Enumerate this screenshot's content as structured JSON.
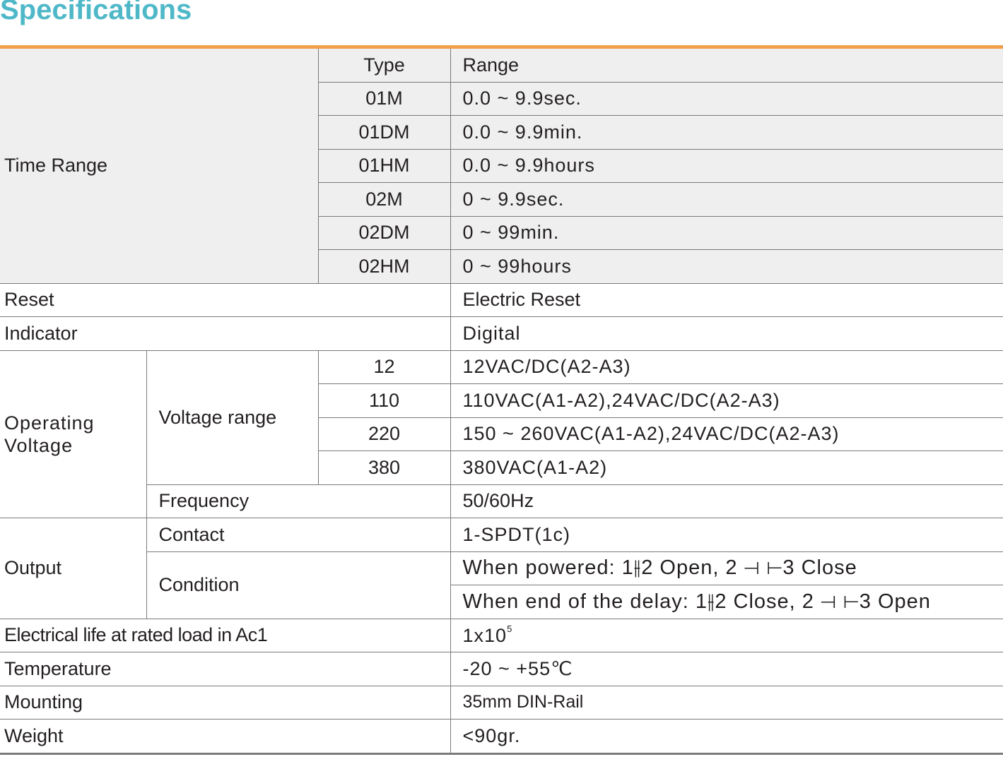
{
  "title": "Specifications",
  "colors": {
    "title": "#4fb8c8",
    "accent_rule": "#f0a04b",
    "shade": "#efefef",
    "border": "#7a7a7a"
  },
  "time_range": {
    "label": "Time Range",
    "header_type": "Type",
    "header_range": "Range",
    "rows": [
      {
        "type": "01M",
        "range": "0.0 ~ 9.9sec."
      },
      {
        "type": "01DM",
        "range": "0.0 ~ 9.9min."
      },
      {
        "type": "01HM",
        "range": "0.0 ~ 9.9hours"
      },
      {
        "type": "02M",
        "range": "0 ~ 9.9sec."
      },
      {
        "type": "02DM",
        "range": "0 ~ 99min."
      },
      {
        "type": "02HM",
        "range": "0 ~ 99hours"
      }
    ]
  },
  "reset": {
    "label": "Reset",
    "value": "Electric Reset"
  },
  "indicator": {
    "label": "Indicator",
    "value": "Digital"
  },
  "operating_voltage": {
    "label_line1": "Operating",
    "label_line2": "Voltage",
    "voltage_range_label": "Voltage range",
    "rows": [
      {
        "code": "12",
        "value": "12VAC/DC(A2-A3)"
      },
      {
        "code": "110",
        "value": "110VAC(A1-A2),24VAC/DC(A2-A3)"
      },
      {
        "code": "220",
        "value": "150 ~ 260VAC(A1-A2),24VAC/DC(A2-A3)"
      },
      {
        "code": "380",
        "value": "380VAC(A1-A2)"
      }
    ],
    "frequency_label": "Frequency",
    "frequency_value": "50/60Hz"
  },
  "output": {
    "label": "Output",
    "contact_label": "Contact",
    "contact_value": "1-SPDT(1c)",
    "condition_label": "Condition",
    "condition_powered": "When powered: 1⫲2 Open, 2 ⊣ ⊢3 Close",
    "condition_delay": "When end of the delay: 1⫲2 Close, 2 ⊣ ⊢3 Open"
  },
  "electrical_life": {
    "label": "Electrical life at rated load in Ac1",
    "base": "1x10",
    "exponent": "5"
  },
  "temperature": {
    "label": "Temperature",
    "value": "-20 ~ +55℃"
  },
  "mounting": {
    "label": "Mounting",
    "value": "35mm DIN-Rail"
  },
  "weight": {
    "label": "Weight",
    "value": "<90gr."
  }
}
